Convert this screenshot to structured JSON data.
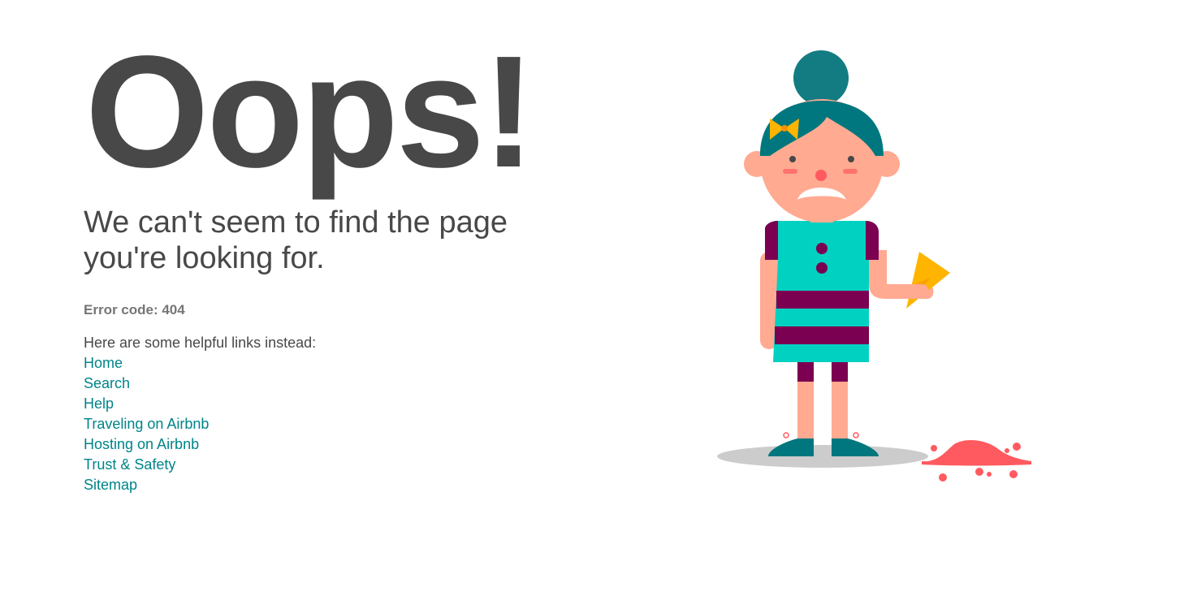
{
  "main": {
    "title": "Oops!",
    "subtitle": "We can't seem to find the page you're looking for.",
    "error_code": "Error code: 404",
    "helpful_text": "Here are some helpful links instead:",
    "links": [
      {
        "label": "Home"
      },
      {
        "label": "Search"
      },
      {
        "label": "Help"
      },
      {
        "label": "Traveling on Airbnb"
      },
      {
        "label": "Hosting on Airbnb"
      },
      {
        "label": "Trust & Safety"
      },
      {
        "label": "Sitemap"
      }
    ]
  },
  "illustration": {
    "icon": "sad-girl-dropped-ice-cream-illustration"
  },
  "colors": {
    "text": "#484848",
    "muted": "#767676",
    "link": "#008489",
    "hair": "#00777E",
    "skin": "#FFAA91",
    "dress": "#00D1C1",
    "stripe": "#7B0051",
    "cone": "#FFB400",
    "icecream": "#FF5A5F"
  }
}
